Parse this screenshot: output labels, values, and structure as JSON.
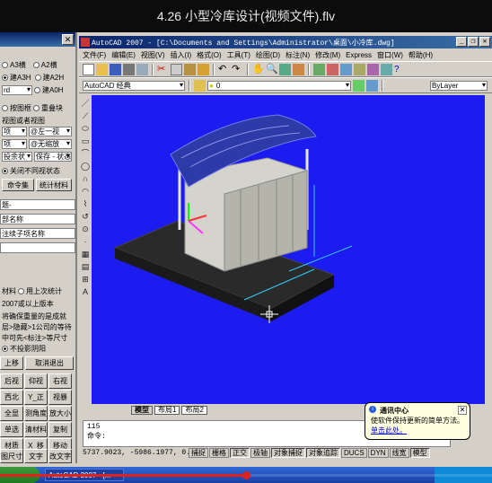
{
  "video": {
    "title": "4.26 小型冷库设计(视频文件).flv",
    "progress": 0.5
  },
  "left_panel": {
    "radios_row1": [
      "A3横",
      "A2横"
    ],
    "radios_row2": [
      "建A3H",
      "建A2H"
    ],
    "radios_row3": [
      "建A0H"
    ],
    "combo_d": "rd",
    "checks": [
      "按图框",
      "重叠块"
    ],
    "caption": "视图或者视图",
    "combo_rows": [
      [
        "项",
        "@左一视"
      ],
      [
        "项",
        "@无缩放"
      ],
      [
        "投余状",
        "保存 - 状态"
      ]
    ],
    "radio_state": "关闭不同视状态",
    "btn_cmd": "命令集",
    "btn_stat": "统计材料",
    "field1": "题-",
    "field2": "部名称",
    "field3": "注续子项名称",
    "text_material": "材料",
    "text_last": "用上次统计",
    "text_block": "2007或以上版本",
    "text_notes": [
      "将确保重量的是成就",
      "层>隐藏>1公司的等待",
      "中可先<标注>等尺寸"
    ],
    "radio_noshadow": "不投影阴阳",
    "btn_top": "上移",
    "btn_cancel": "取消退出",
    "grid_buttons": [
      [
        "后视",
        "仰视",
        "右视"
      ],
      [
        "西北",
        "Y_正",
        "视暴"
      ],
      [
        "全显",
        "测角度",
        "放大小"
      ],
      [
        "单选",
        "清材料",
        "复制"
      ],
      [
        "材质",
        "X_移",
        "移动"
      ],
      [
        "图尺寸",
        "文字",
        "改文字"
      ]
    ]
  },
  "acad": {
    "title": "AutoCAD 2007 - [C:\\Documents and Settings\\Administrator\\桌面\\小冷库.dwg]",
    "menus": [
      "文件(F)",
      "编辑(E)",
      "视图(V)",
      "插入(I)",
      "格式(O)",
      "工具(T)",
      "绘图(D)",
      "标注(N)",
      "修改(M)",
      "Express",
      "窗口(W)",
      "帮助(H)"
    ],
    "workspace": "AutoCAD 经典",
    "layer": "0",
    "linetype": "ByLayer",
    "draw_tools": [
      "／",
      "⟋",
      "⬭",
      "▭",
      "⌒",
      "◯",
      "∩",
      "◠",
      "⌇",
      "↺",
      "⊙",
      "·",
      "▦",
      "▤",
      "⊞",
      "A"
    ],
    "tabs": [
      "模型",
      "布局1",
      "布局2"
    ],
    "cmd_lines": [
      "115",
      "命令:"
    ],
    "coords": "5737.9023, -5986.1977, 0.0000",
    "status_buttons": [
      {
        "label": "捕捉",
        "on": false
      },
      {
        "label": "栅格",
        "on": false
      },
      {
        "label": "正交",
        "on": true
      },
      {
        "label": "极轴",
        "on": false
      },
      {
        "label": "对象捕捉",
        "on": true
      },
      {
        "label": "对象追踪",
        "on": true
      },
      {
        "label": "DUCS",
        "on": false
      },
      {
        "label": "DYN",
        "on": false
      },
      {
        "label": "线宽",
        "on": false
      },
      {
        "label": "模型",
        "on": true
      }
    ],
    "drawing_bg": "#1c1cf0"
  },
  "balloon": {
    "title": "通讯中心",
    "text": "使软件保持更新的简单方法。",
    "link": "单击此处。"
  },
  "taskbar": {
    "task": "AutoCAD 2007 - [..."
  }
}
